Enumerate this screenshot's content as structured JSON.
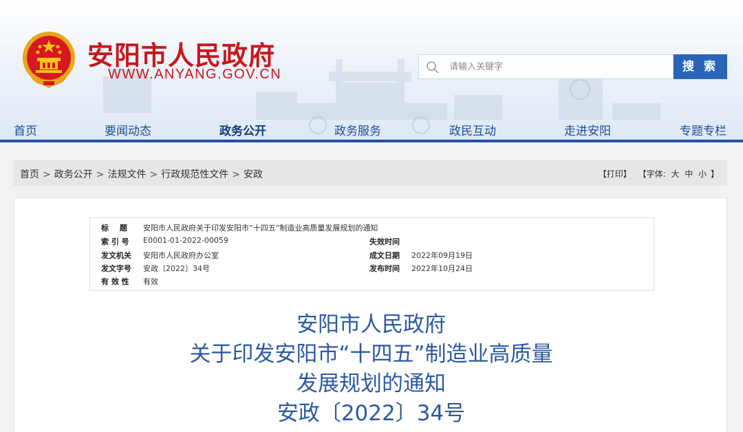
{
  "header": {
    "site_name": "安阳市人民政府",
    "site_url": "WWW.ANYANG.GOV.CN",
    "emblem_icon": "national-emblem-icon",
    "search": {
      "placeholder": "请输入关键字",
      "button_label": "搜 索"
    }
  },
  "nav": {
    "items": [
      {
        "label": "首页"
      },
      {
        "label": "要闻动态"
      },
      {
        "label": "政务公开",
        "active": true
      },
      {
        "label": "政务服务"
      },
      {
        "label": "政民互动"
      },
      {
        "label": "走进安阳"
      },
      {
        "label": "专题专栏"
      }
    ]
  },
  "breadcrumb": {
    "items": [
      "首页",
      "政务公开",
      "法规文件",
      "行政规范性文件",
      "安政"
    ],
    "separator": ">",
    "print_label": "【打印】",
    "font_label": "【字体:",
    "font_large": "大",
    "font_medium": "中",
    "font_small": "小",
    "font_close": "】"
  },
  "meta": {
    "title_label": "标 题",
    "title_value": "安阳市人民政府关于印发安阳市“十四五”制造业高质量发展规划的通知",
    "index_label": "索 引 号",
    "index_value": "E0001-01-2022-00059",
    "expire_label": "失效时间",
    "expire_value": "",
    "issuer_label": "发文机关",
    "issuer_value": "安阳市人民政府办公室",
    "created_label": "成文日期",
    "created_value": "2022年09月19日",
    "docno_label": "发文字号",
    "docno_value": "安政〔2022〕34号",
    "published_label": "发布时间",
    "published_value": "2022年10月24日",
    "validity_label": "有 效 性",
    "validity_value": "有效"
  },
  "document": {
    "title_lines": [
      "安阳市人民政府",
      "关于印发安阳市“十四五”制造业高质量",
      "发展规划的通知",
      "安政〔2022〕34号"
    ]
  },
  "colors": {
    "brand_red": "#c8171d",
    "nav_blue": "#1d4f96",
    "accent_blue": "#2a64b8",
    "title_blue": "#2c5aa0"
  }
}
